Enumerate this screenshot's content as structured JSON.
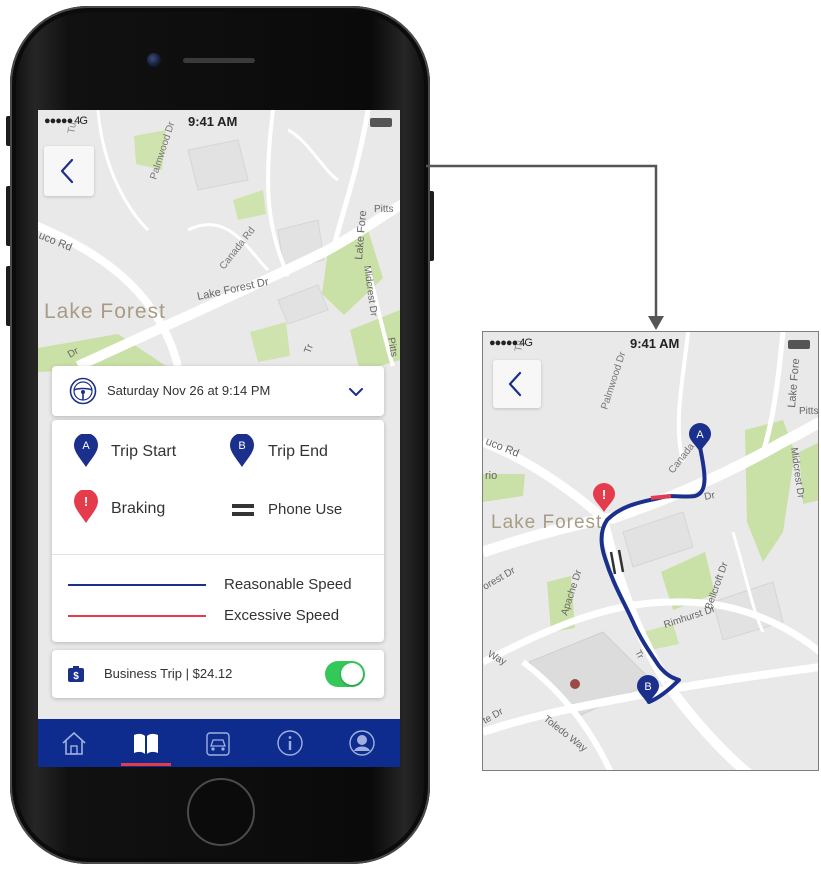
{
  "status_bar": {
    "signal": "●●●●● 4G",
    "time": "9:41 AM"
  },
  "map_labels": {
    "lake_forest": "Lake Forest",
    "lake_forest_dr": "Lake Forest Dr",
    "canada_rd": "Canada Rd",
    "palmwood_dr": "Palmwood Dr",
    "muco_rd": "uco Rd",
    "midcrest_dr": "Midcrest Dr",
    "pitts": "Pitts",
    "tu": "Tu",
    "lake_fore_vertical": "Lake Fore",
    "apache_dr": "Apache Dr",
    "rimhurst_dr": "Rimhurst Dr",
    "bellcroft_dr": "Bellcroft Dr",
    "toledo_way": "Toledo Way",
    "orest_dr": "orest Dr",
    "way": "Way",
    "te_dr": "te Dr",
    "rio": "rio",
    "sr_dr": "sr Dr",
    "tr": "Tr",
    "dr": "Dr"
  },
  "trip": {
    "date_label": "Saturday Nov 26 at 9:14 PM",
    "legend": {
      "trip_start": "Trip Start",
      "trip_end": "Trip End",
      "braking": "Braking",
      "phone_use": "Phone Use",
      "reasonable_speed": "Reasonable Speed",
      "excessive_speed": "Excessive Speed"
    },
    "markers": {
      "a": "A",
      "b": "B",
      "alert": "!"
    }
  },
  "business": {
    "label": "Business Trip  |  $24.12",
    "toggle_on": true
  },
  "tabs": [
    {
      "id": "home",
      "icon": "home-icon",
      "active": false
    },
    {
      "id": "trips",
      "icon": "book-icon",
      "active": true
    },
    {
      "id": "car",
      "icon": "car-icon",
      "active": false
    },
    {
      "id": "info",
      "icon": "info-icon",
      "active": false
    },
    {
      "id": "profile",
      "icon": "profile-icon",
      "active": false
    }
  ],
  "colors": {
    "route_blue": "#1b2f8c",
    "alert_red": "#e43b4d",
    "nav_blue": "#0e2c8e",
    "toggle_green": "#34c759",
    "map_bg": "#e9e9e9",
    "park_green": "#c9e1a6"
  }
}
